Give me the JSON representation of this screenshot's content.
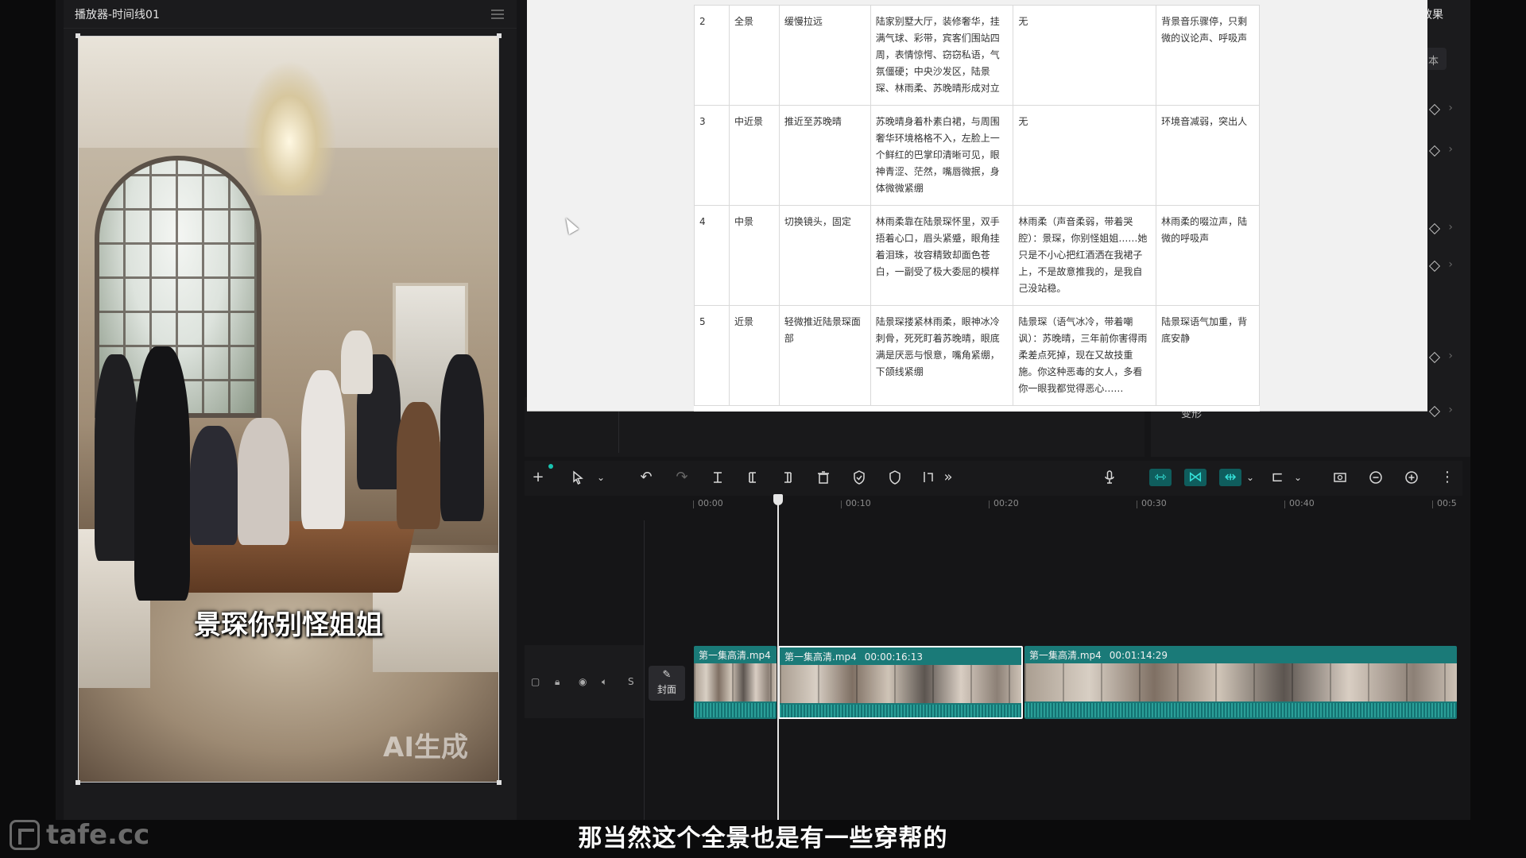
{
  "player": {
    "title": "播放器-时间线01",
    "subtitle": "景琛你别怪姐姐",
    "watermark": "AI生成"
  },
  "document": {
    "rows": [
      [
        "2",
        "全景",
        "缓慢拉远",
        "陆家别墅大厅，装修奢华，挂满气球、彩带，宾客们围站四周，表情惊愕、窃窃私语，气氛僵硬；中央沙发区，陆景琛、林雨柔、苏晚晴形成对立",
        "无",
        "背景音乐骤停，只剩微的议论声、呼吸声"
      ],
      [
        "3",
        "中近景",
        "推近至苏晚晴",
        "苏晚晴身着朴素白裙，与周围奢华环境格格不入，左脸上一个鲜红的巴掌印清晰可见，眼神青涩、茫然，嘴唇微抿，身体微微紧绷",
        "无",
        "环境音减弱，突出人"
      ],
      [
        "4",
        "中景",
        "切换镜头，固定",
        "林雨柔靠在陆景琛怀里，双手捂着心口，眉头紧蹙，眼角挂着泪珠，妆容精致却面色苍白，一副受了极大委屈的模样",
        "林雨柔（声音柔弱，带着哭腔）：景琛，你别怪姐姐……她只是不小心把红酒洒在我裙子上，不是故意推我的，是我自己没站稳。",
        "林雨柔的啜泣声，陆微的呼吸声"
      ],
      [
        "5",
        "近景",
        "轻微推近陆景琛面部",
        "陆景琛搂紧林雨柔，眼神冰冷刺骨，死死盯着苏晚晴，眼底满是厌恶与恨意，嘴角紧绷，下颌线紧绷",
        "陆景琛（语气冰冷，带着嘲讽）：苏晚晴，三年前你害得雨柔差点死掉，现在又故技重施。你这种恶毒的女人，多看你一眼我都觉得恶心……",
        "陆景琛语气加重，背底安静"
      ]
    ]
  },
  "right_panel": {
    "title": "效果",
    "button": "本",
    "label": "变形"
  },
  "ruler": {
    "ticks": [
      "00:00",
      "00:10",
      "00:20",
      "00:30",
      "00:40",
      "00:5"
    ]
  },
  "track": {
    "cover_label": "封面",
    "solo_label": "S",
    "clips": [
      {
        "name": "第一集高清.mp4",
        "duration": ""
      },
      {
        "name": "第一集高清.mp4",
        "duration": "00:00:16:13"
      },
      {
        "name": "第一集高清.mp4",
        "duration": "00:01:14:29"
      }
    ]
  },
  "caption": "那当然这个全景也是有一些穿帮的",
  "brand": "tafe.cc",
  "colors": {
    "accent": "#18c3c3",
    "clip": "#1a7a78"
  }
}
